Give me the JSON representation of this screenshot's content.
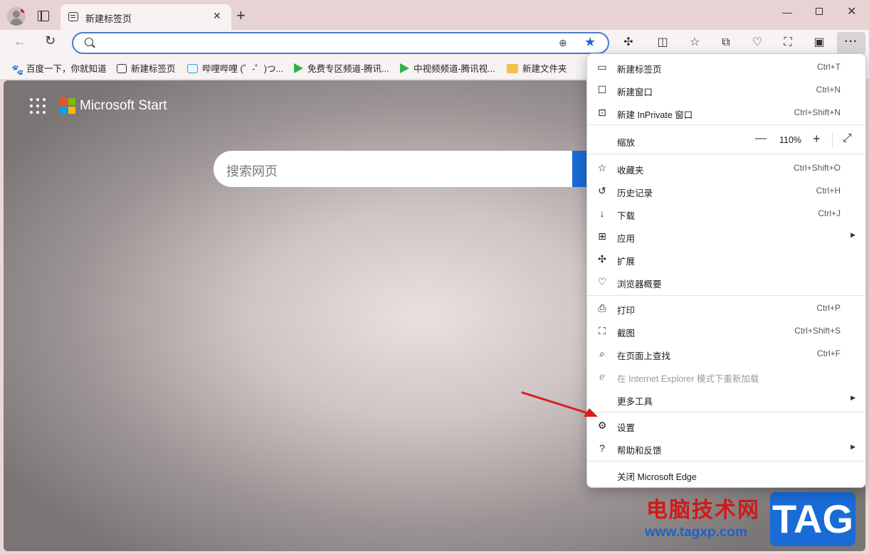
{
  "browser": {
    "tab_title": "新建标签页",
    "new_tab_symbol": "+",
    "close_symbol": "✕",
    "window_controls": {
      "minimize": "—",
      "maximize": "",
      "close": "✕"
    }
  },
  "toolbar": {
    "back_symbol": "←",
    "reload_symbol": "↻",
    "address_value": "",
    "more_symbol": "···"
  },
  "bookmarks": [
    {
      "label": "百度一下，你就知道",
      "icon": "baidu-paw-icon"
    },
    {
      "label": "新建标签页",
      "icon": "new-tab-icon"
    },
    {
      "label": "哔哩哔哩 (゜-゜)つ...",
      "icon": "bilibili-icon"
    },
    {
      "label": "免费专区频道-腾讯...",
      "icon": "tencent-video-icon"
    },
    {
      "label": "中视频频道-腾讯视...",
      "icon": "tencent-video-icon"
    },
    {
      "label": "新建文件夹",
      "icon": "folder-icon"
    }
  ],
  "page": {
    "brand": "Microsoft Start",
    "search_placeholder": "搜索网页"
  },
  "menu": {
    "items_top": [
      {
        "label": "新建标签页",
        "shortcut": "Ctrl+T",
        "icon": "new-tab-icon"
      },
      {
        "label": "新建窗口",
        "shortcut": "Ctrl+N",
        "icon": "new-window-icon"
      },
      {
        "label": "新建 InPrivate 窗口",
        "shortcut": "Ctrl+Shift+N",
        "icon": "inprivate-icon"
      }
    ],
    "zoom": {
      "label": "缩放",
      "value": "110%",
      "minus": "—",
      "plus": "+"
    },
    "items_mid": [
      {
        "label": "收藏夹",
        "shortcut": "Ctrl+Shift+O",
        "icon": "favorites-icon"
      },
      {
        "label": "历史记录",
        "shortcut": "Ctrl+H",
        "icon": "history-icon"
      },
      {
        "label": "下载",
        "shortcut": "Ctrl+J",
        "icon": "download-icon"
      },
      {
        "label": "应用",
        "shortcut": "",
        "icon": "apps-icon",
        "submenu": true
      },
      {
        "label": "扩展",
        "shortcut": "",
        "icon": "extensions-icon"
      },
      {
        "label": "浏览器概要",
        "shortcut": "",
        "icon": "browser-essentials-icon"
      }
    ],
    "items_tools": [
      {
        "label": "打印",
        "shortcut": "Ctrl+P",
        "icon": "print-icon"
      },
      {
        "label": "截图",
        "shortcut": "Ctrl+Shift+S",
        "icon": "screenshot-icon"
      },
      {
        "label": "在页面上查找",
        "shortcut": "Ctrl+F",
        "icon": "find-icon"
      },
      {
        "label": "在 Internet Explorer 模式下重新加载",
        "shortcut": "",
        "icon": "ie-mode-icon",
        "disabled": true
      },
      {
        "label": "更多工具",
        "shortcut": "",
        "icon": "",
        "submenu": true
      }
    ],
    "items_settings": [
      {
        "label": "设置",
        "shortcut": "",
        "icon": "gear-icon"
      },
      {
        "label": "帮助和反馈",
        "shortcut": "",
        "icon": "help-icon",
        "submenu": true
      }
    ],
    "close_label": "关闭 Microsoft Edge"
  },
  "watermark": {
    "site_name": "电脑技术网",
    "url": "www.tagxp.com",
    "badge": "TAG"
  },
  "colors": {
    "accent": "#1a6bd6",
    "annotation_arrow": "#d81e1e"
  }
}
